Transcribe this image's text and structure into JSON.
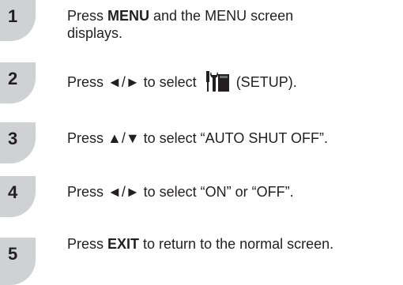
{
  "steps": [
    {
      "number": "1",
      "parts": {
        "pre": "Press ",
        "bold": "MENU",
        "post": " and the MENU screen",
        "line2": "displays."
      }
    },
    {
      "number": "2",
      "parts": {
        "pre": "Press ◄/► to select ",
        "post": " (SETUP)."
      },
      "icon": "setup-wrench-screwdriver-icon"
    },
    {
      "number": "3",
      "parts": {
        "pre": "Press ▲/▼ to select “AUTO SHUT OFF”."
      }
    },
    {
      "number": "4",
      "parts": {
        "pre": "Press ◄/► to select “ON” or “OFF”."
      }
    },
    {
      "number": "5",
      "parts": {
        "pre": "Press ",
        "bold": "EXIT",
        "post": " to return to the normal screen."
      }
    }
  ],
  "colors": {
    "badge": "#d0d1d3",
    "text": "#231f20"
  }
}
